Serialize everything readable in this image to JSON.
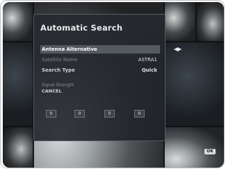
{
  "dialog": {
    "title": "Automatic Search",
    "rows": [
      {
        "label": "Antenna Alternative",
        "value": "",
        "state": "selected"
      },
      {
        "label": "Satellite Name",
        "value": "ASTRA1",
        "state": "dim"
      },
      {
        "label": "Search Type",
        "value": "Quick",
        "state": "normal"
      }
    ],
    "section_label": "Signal Strength",
    "status_text": "CANCEL",
    "buttons": [
      "0",
      "0",
      "0",
      "0"
    ]
  },
  "side": {
    "nav_arrows": "◀▶",
    "badge": "OK"
  }
}
